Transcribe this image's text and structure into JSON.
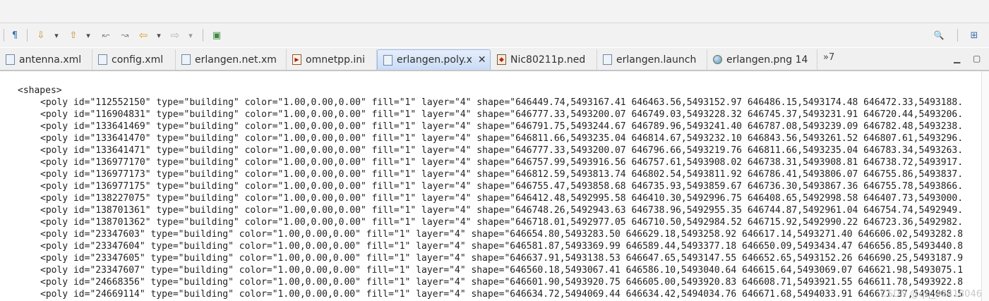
{
  "toolbar": {
    "icons": [
      {
        "name": "pilcrow-icon",
        "glyph": "¶"
      },
      {
        "name": "next-annotation-icon",
        "glyph": "⇩"
      },
      {
        "name": "next-annotation-dropdown-icon",
        "glyph": "▾"
      },
      {
        "name": "previous-annotation-icon",
        "glyph": "⇧"
      },
      {
        "name": "previous-annotation-dropdown-icon",
        "glyph": "▾"
      },
      {
        "name": "last-edit-location-icon",
        "glyph": "↜"
      },
      {
        "name": "next-edit-location-icon",
        "glyph": "↝"
      },
      {
        "name": "back-icon",
        "glyph": "⇦"
      },
      {
        "name": "back-dropdown-icon",
        "glyph": "▾"
      },
      {
        "name": "forward-icon",
        "glyph": "⇨"
      },
      {
        "name": "forward-dropdown-icon",
        "glyph": "▾"
      },
      {
        "name": "open-perspective-icon",
        "glyph": "▣"
      },
      {
        "name": "search-icon",
        "glyph": "🔍"
      },
      {
        "name": "perspective-icon",
        "glyph": "⊞"
      }
    ]
  },
  "tabs": [
    {
      "label": "antenna.xml",
      "icon": "xml-file-icon",
      "active": false
    },
    {
      "label": "config.xml",
      "icon": "xml-file-icon",
      "active": false
    },
    {
      "label": "erlangen.net.xm",
      "icon": "xml-file-icon",
      "active": false
    },
    {
      "label": "omnetpp.ini",
      "icon": "ini-file-icon",
      "active": false
    },
    {
      "label": "erlangen.poly.x",
      "icon": "xml-file-icon",
      "active": true
    },
    {
      "label": "Nic80211p.ned",
      "icon": "ned-file-icon",
      "active": false
    },
    {
      "label": "erlangen.launch",
      "icon": "launch-file-icon",
      "active": false
    },
    {
      "label": "erlangen.png 14",
      "icon": "image-file-icon",
      "active": false
    }
  ],
  "tab_overflow": "»7",
  "editor": {
    "lines": [
      "<shapes>",
      "<poly id=\"112552150\" type=\"building\" color=\"1.00,0.00,0.00\" fill=\"1\" layer=\"4\" shape=\"646449.74,5493167.41 646463.56,5493152.97 646486.15,5493174.48 646472.33,5493188.",
      "<poly id=\"116904831\" type=\"building\" color=\"1.00,0.00,0.00\" fill=\"1\" layer=\"4\" shape=\"646777.33,5493200.07 646749.03,5493228.32 646745.37,5493231.91 646720.44,5493206.",
      "<poly id=\"133641469\" type=\"building\" color=\"1.00,0.00,0.00\" fill=\"1\" layer=\"4\" shape=\"646791.75,5493244.67 646789.96,5493241.40 646787.08,5493239.09 646782.48,5493238.",
      "<poly id=\"133641470\" type=\"building\" color=\"1.00,0.00,0.00\" fill=\"1\" layer=\"4\" shape=\"646811.66,5493235.04 646814.67,5493232.10 646843.56,5493261.52 646807.61,5493296.",
      "<poly id=\"133641471\" type=\"building\" color=\"1.00,0.00,0.00\" fill=\"1\" layer=\"4\" shape=\"646777.33,5493200.07 646796.66,5493219.76 646811.66,5493235.04 646783.34,5493263.",
      "<poly id=\"136977170\" type=\"building\" color=\"1.00,0.00,0.00\" fill=\"1\" layer=\"4\" shape=\"646757.99,5493916.56 646757.61,5493908.02 646738.31,5493908.81 646738.72,5493917.",
      "<poly id=\"136977173\" type=\"building\" color=\"1.00,0.00,0.00\" fill=\"1\" layer=\"4\" shape=\"646812.59,5493813.74 646802.54,5493811.92 646786.41,5493806.07 646755.86,5493837.",
      "<poly id=\"136977175\" type=\"building\" color=\"1.00,0.00,0.00\" fill=\"1\" layer=\"4\" shape=\"646755.47,5493858.68 646735.93,5493859.67 646736.30,5493867.36 646755.78,5493866.",
      "<poly id=\"138227075\" type=\"building\" color=\"1.00,0.00,0.00\" fill=\"1\" layer=\"4\" shape=\"646412.48,5492995.58 646410.30,5492996.75 646408.65,5492998.58 646407.73,5493000.",
      "<poly id=\"138701361\" type=\"building\" color=\"1.00,0.00,0.00\" fill=\"1\" layer=\"4\" shape=\"646748.26,5492943.63 646738.96,5492955.35 646744.87,5492961.04 646754.74,5492949.",
      "<poly id=\"138701362\" type=\"building\" color=\"1.00,0.00,0.00\" fill=\"1\" layer=\"4\" shape=\"646718.01,5492977.05 646710.50,5492984.52 646715.92,5492990.22 646723.36,5492982.",
      "<poly id=\"23347603\" type=\"building\" color=\"1.00,0.00,0.00\" fill=\"1\" layer=\"4\" shape=\"646654.80,5493283.50 646629.18,5493258.92 646617.14,5493271.40 646606.02,5493282.8",
      "<poly id=\"23347604\" type=\"building\" color=\"1.00,0.00,0.00\" fill=\"1\" layer=\"4\" shape=\"646581.87,5493369.99 646589.44,5493377.18 646650.09,5493434.47 646656.85,5493440.8",
      "<poly id=\"23347605\" type=\"building\" color=\"1.00,0.00,0.00\" fill=\"1\" layer=\"4\" shape=\"646637.91,5493138.53 646647.65,5493147.55 646652.65,5493152.26 646690.25,5493187.9",
      "<poly id=\"23347607\" type=\"building\" color=\"1.00,0.00,0.00\" fill=\"1\" layer=\"4\" shape=\"646560.18,5493067.41 646586.10,5493040.64 646615.64,5493069.07 646621.98,5493075.1",
      "<poly id=\"24668356\" type=\"building\" color=\"1.00,0.00,0.00\" fill=\"1\" layer=\"4\" shape=\"646601.90,5493920.75 646605.00,5493920.83 646608.71,5493921.55 646611.78,5493922.8",
      "<poly id=\"24669114\" type=\"building\" color=\"1.00,0.00,0.00\" fill=\"1\" layer=\"4\" shape=\"646634.72,5494069.44 646634.42,5494034.76 646671.68,5494033.91 646671.37,5494068.5"
    ]
  },
  "watermark": "CSDN @qq_42418046",
  "colors": {
    "active_tab": "#c9dcf6",
    "tabbar_bg": "#f0f0f0",
    "editor_bg": "#ffffff"
  }
}
